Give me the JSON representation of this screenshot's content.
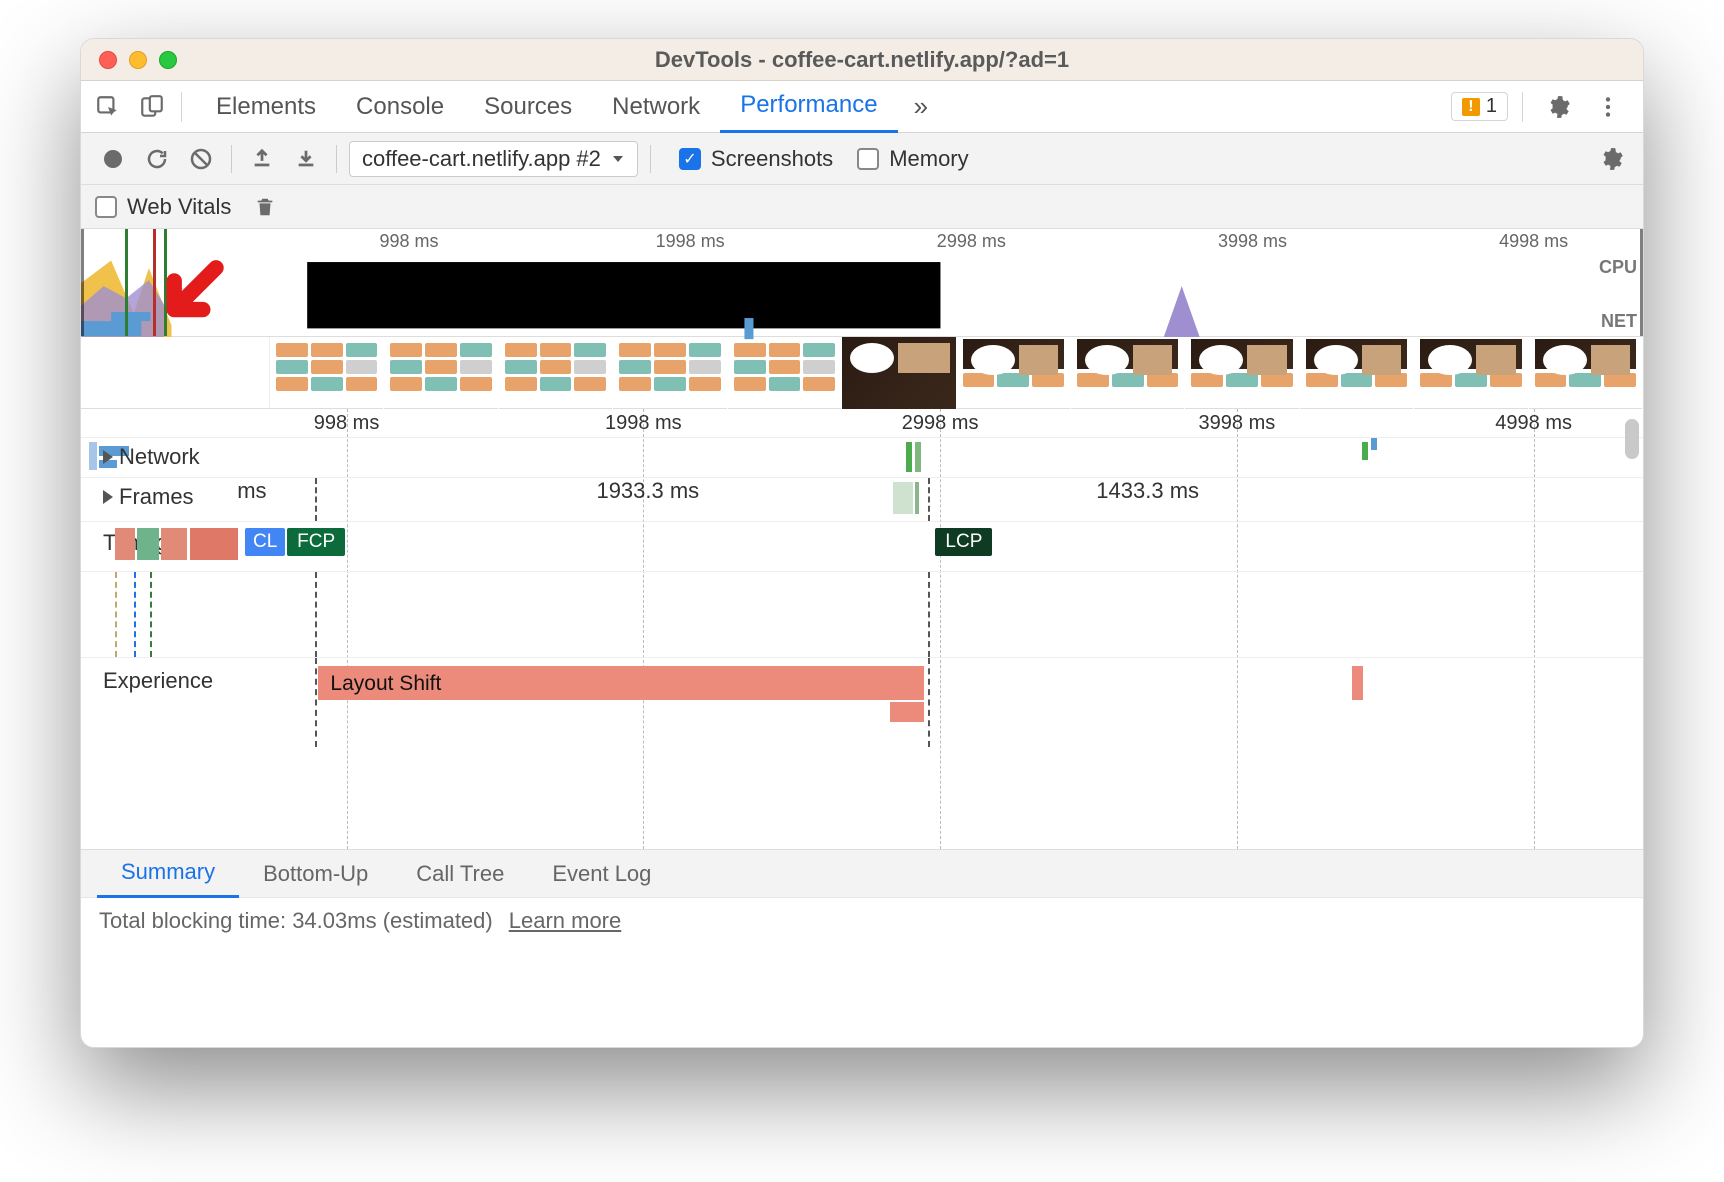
{
  "window": {
    "title": "DevTools - coffee-cart.netlify.app/?ad=1"
  },
  "tabs": {
    "items": [
      "Elements",
      "Console",
      "Sources",
      "Network",
      "Performance"
    ],
    "active": "Performance",
    "issues_count": "1"
  },
  "perf_toolbar": {
    "profile_label": "coffee-cart.netlify.app #2",
    "screenshots_label": "Screenshots",
    "screenshots_checked": true,
    "memory_label": "Memory",
    "memory_checked": false,
    "web_vitals_label": "Web Vitals",
    "web_vitals_checked": false
  },
  "overview": {
    "ticks": [
      "998 ms",
      "1998 ms",
      "2998 ms",
      "3998 ms",
      "4998 ms"
    ],
    "cpu_label": "CPU",
    "net_label": "NET"
  },
  "flame": {
    "ticks": [
      "998 ms",
      "1998 ms",
      "2998 ms",
      "3998 ms",
      "4998 ms"
    ],
    "network_label": "Network",
    "frames_label": "Frames",
    "frames_values": [
      "1933.3 ms",
      "1433.3 ms"
    ],
    "frames_partial": "ms",
    "timings_label": "Timings",
    "timing_cl": "CL",
    "timing_fcp": "FCP",
    "timing_lcp": "LCP",
    "experience_label": "Experience",
    "layout_shift_label": "Layout Shift"
  },
  "bottom_tabs": [
    "Summary",
    "Bottom-Up",
    "Call Tree",
    "Event Log"
  ],
  "status": {
    "text": "Total blocking time: 34.03ms (estimated)",
    "link": "Learn more"
  }
}
